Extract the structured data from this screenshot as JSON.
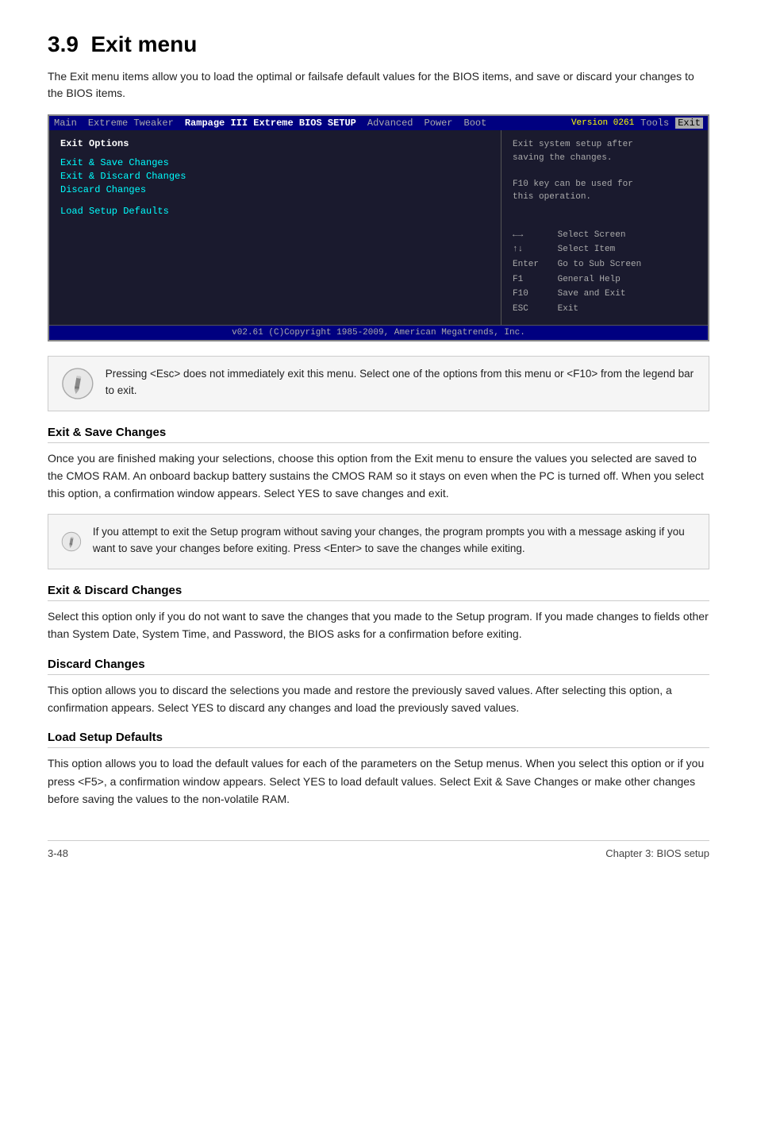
{
  "page": {
    "section_number": "3.9",
    "title": "Exit menu",
    "intro": "The Exit menu items allow you to load the optimal or failsafe default values for the BIOS items, and save or discard your changes to the BIOS items."
  },
  "bios": {
    "title": "Rampage III Extreme BIOS SETUP",
    "version": "Version 0261",
    "menu_items": [
      "Main",
      "Extreme Tweaker",
      "Advanced",
      "Power",
      "Boot",
      "Tools",
      "Exit"
    ],
    "active_item": "Exit",
    "left_section_label": "Exit Options",
    "options": [
      "Exit & Save Changes",
      "Exit & Discard Changes",
      "Discard Changes",
      "",
      "Load Setup Defaults"
    ],
    "help_line1": "Exit system setup after",
    "help_line2": "saving the changes.",
    "help_line3": "",
    "help_line4": "F10 key can be used for",
    "help_line5": "this operation.",
    "legend": [
      {
        "key": "←→",
        "desc": "Select Screen"
      },
      {
        "key": "↑↓",
        "desc": "Select Item"
      },
      {
        "key": "Enter",
        "desc": "Go to Sub Screen"
      },
      {
        "key": "F1",
        "desc": "General Help"
      },
      {
        "key": "F10",
        "desc": "Save and Exit"
      },
      {
        "key": "ESC",
        "desc": "Exit"
      }
    ],
    "footer": "v02.61  (C)Copyright 1985-2009, American Megatrends, Inc."
  },
  "note1": {
    "text": "Pressing <Esc> does not immediately exit this menu. Select one of the options from this menu or <F10> from the legend bar to exit."
  },
  "sections": [
    {
      "id": "exit-save",
      "heading": "Exit & Save Changes",
      "body": "Once you are finished making your selections, choose this option from the Exit menu to ensure the values you selected are saved to the CMOS RAM. An onboard backup battery sustains the CMOS RAM so it stays on even when the PC is turned off. When you select this option, a confirmation window appears. Select YES to save changes and exit."
    },
    {
      "id": "exit-discard",
      "heading": "Exit & Discard Changes",
      "body": "Select this option only if you do not want to save the changes that you  made to the Setup program. If you made changes to fields other than System Date, System Time, and Password, the BIOS asks for a confirmation before exiting."
    },
    {
      "id": "discard-changes",
      "heading": "Discard Changes",
      "body": "This option allows you to discard the selections you made and restore the previously saved values. After selecting this option, a confirmation appears. Select YES to discard any changes and load the previously saved values."
    },
    {
      "id": "load-defaults",
      "heading": "Load Setup Defaults",
      "body": "This option allows you to load the default values for each of the parameters on the Setup menus. When you select this option or if you press <F5>, a confirmation window appears. Select YES to load default values. Select Exit & Save Changes or make other changes before saving the values to the non-volatile RAM."
    }
  ],
  "note2": {
    "text": " If you attempt to exit the Setup program without saving your changes, the program prompts you with a message asking if you want to save your changes before exiting. Press <Enter>  to save the changes while exiting."
  },
  "footer": {
    "page_number": "3-48",
    "chapter": "Chapter 3: BIOS setup"
  }
}
